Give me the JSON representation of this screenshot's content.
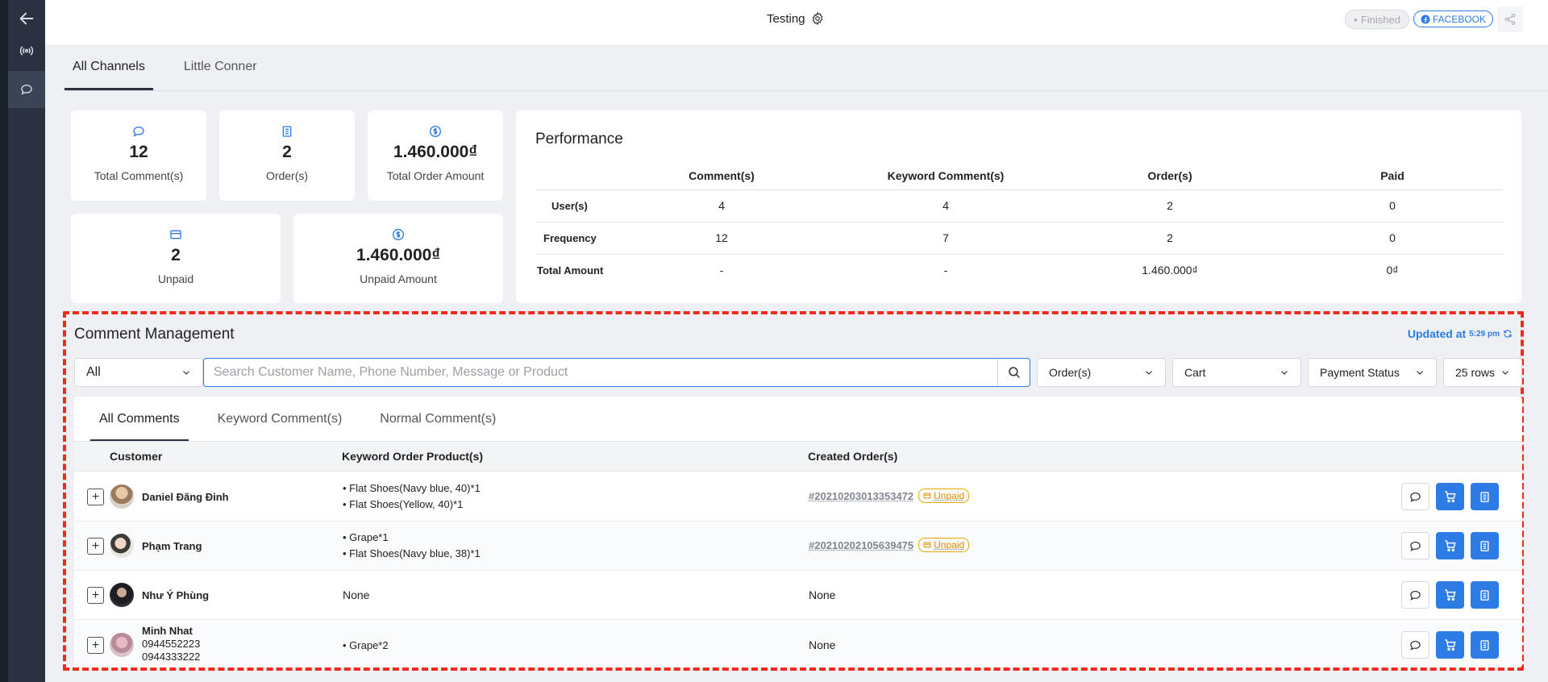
{
  "header": {
    "title": "Testing",
    "status_label": "Finished",
    "platform_label": "FACEBOOK"
  },
  "channel_tabs": [
    "All Channels",
    "Little Conner"
  ],
  "stats": {
    "total_comments": {
      "value": "12",
      "label": "Total Comment(s)"
    },
    "orders": {
      "value": "2",
      "label": "Order(s)"
    },
    "total_order_amount": {
      "value": "1.460.000₫",
      "label": "Total Order Amount"
    },
    "unpaid": {
      "value": "2",
      "label": "Unpaid"
    },
    "unpaid_amount": {
      "value": "1.460.000₫",
      "label": "Unpaid Amount"
    }
  },
  "performance": {
    "title": "Performance",
    "columns": [
      "Comment(s)",
      "Keyword Comment(s)",
      "Order(s)",
      "Paid"
    ],
    "rows": [
      {
        "label": "User(s)",
        "values": [
          "4",
          "4",
          "2",
          "0"
        ]
      },
      {
        "label": "Frequency",
        "values": [
          "12",
          "7",
          "2",
          "0"
        ]
      },
      {
        "label": "Total Amount",
        "values": [
          "-",
          "-",
          "1.460.000₫",
          "0₫"
        ]
      }
    ]
  },
  "comment_management": {
    "title": "Comment Management",
    "updated_label": "Updated at",
    "updated_time": "5:29 pm",
    "filters": {
      "scope": "All",
      "search_placeholder": "Search Customer Name, Phone Number, Message or Product",
      "orders": "Order(s)",
      "cart": "Cart",
      "payment_status": "Payment Status",
      "rows": "25 rows"
    },
    "tabs": [
      "All Comments",
      "Keyword Comment(s)",
      "Normal Comment(s)"
    ],
    "columns": {
      "customer": "Customer",
      "keyword_products": "Keyword Order Product(s)",
      "created_orders": "Created Order(s)"
    },
    "rows": [
      {
        "name": "Daniel Đăng Đinh",
        "products": [
          "• Flat Shoes(Navy blue, 40)*1",
          "• Flat Shoes(Yellow, 40)*1"
        ],
        "order": "#20210203013353472",
        "badge": "Unpaid"
      },
      {
        "name": "Phạm Trang",
        "products": [
          "• Grape*1",
          "• Flat Shoes(Navy blue, 38)*1"
        ],
        "order": "#20210202105639475",
        "badge": "Unpaid"
      },
      {
        "name": "Như Ý Phùng",
        "products_none": "None",
        "order_none": "None"
      },
      {
        "name": "Minh Nhat",
        "phone1": "0944552223",
        "phone2": "0944333222",
        "products": [
          "• Grape*2"
        ],
        "order_none": "None"
      }
    ]
  },
  "icons": [
    "back-arrow-icon",
    "broadcast-icon",
    "chat-icon",
    "gear-icon",
    "share-icon",
    "facebook-icon",
    "search-icon",
    "chevron-down-icon",
    "refresh-icon",
    "cart-icon",
    "clipboard-icon",
    "credit-card-icon",
    "dollar-icon",
    "expand-icon"
  ],
  "colors": {
    "accent": "#2d7be5",
    "sidebar": "#2a3241",
    "highlight": "#ef2b1f",
    "unpaid": "#e08a00"
  }
}
